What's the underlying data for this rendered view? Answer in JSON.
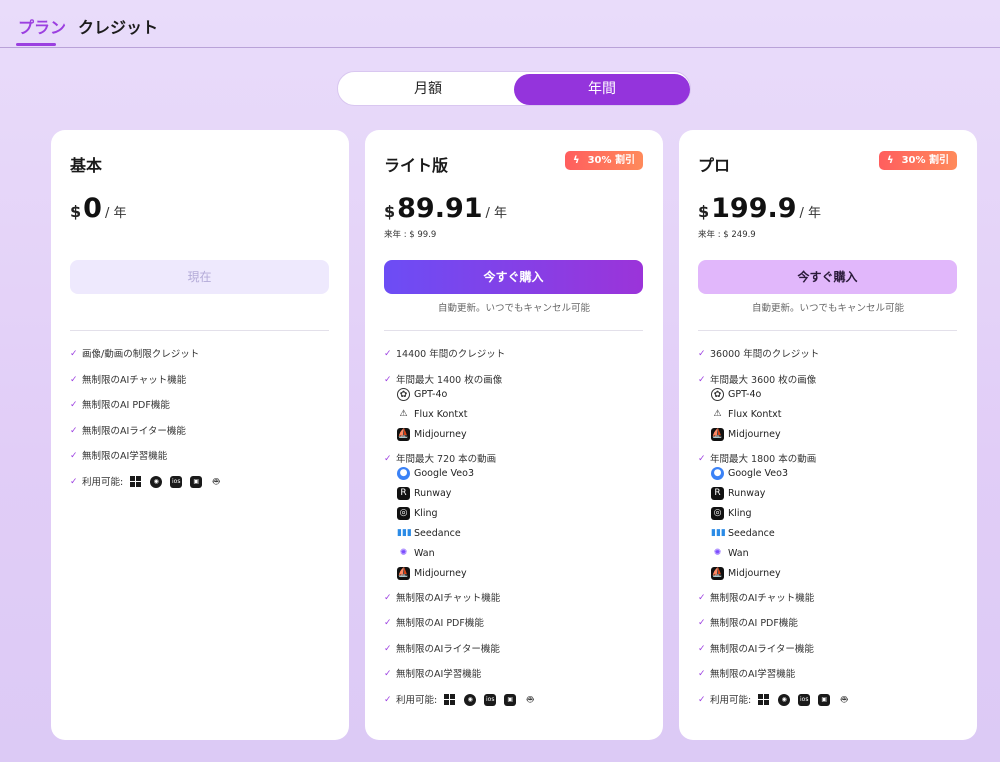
{
  "tabs": [
    {
      "label": "プラン"
    },
    {
      "label": "クレジット"
    }
  ],
  "billing_toggle": {
    "monthly": "月額",
    "yearly": "年間",
    "selected": "yearly"
  },
  "colors": {
    "accent": "#9434dc",
    "badge": "#ff6a5b",
    "check": "#9b3fe0"
  },
  "cards": [
    {
      "title": "基本",
      "currency": "$",
      "price": "0",
      "unit": "/ 年",
      "cta": "現在",
      "features": [
        "画像/動画の制限クレジット",
        "無制限のAIチャット機能",
        "無制限のAI PDF機能",
        "無制限のAIライター機能",
        "無制限のAI学習機能",
        "利用可能:"
      ]
    },
    {
      "title": "ライト版",
      "badge": "30% 割引",
      "currency": "$",
      "price": "89.91",
      "unit": "/ 年",
      "next_year": "来年 : $ 99.9",
      "cta": "今すぐ購入",
      "renew_note": "自動更新。いつでもキャンセル可能",
      "credits": "14400 年間のクレジット",
      "images_head": "年間最大 1400 枚の画像",
      "image_models": [
        "GPT-4o",
        "Flux Kontxt",
        "Midjourney"
      ],
      "videos_head": "年間最大 720 本の動画",
      "video_models": [
        "Google Veo3",
        "Runway",
        "Kling",
        "Seedance",
        "Wan",
        "Midjourney"
      ],
      "features": [
        "無制限のAIチャット機能",
        "無制限のAI PDF機能",
        "無制限のAIライター機能",
        "無制限のAI学習機能",
        "利用可能:"
      ]
    },
    {
      "title": "プロ",
      "badge": "30% 割引",
      "currency": "$",
      "price": "199.9",
      "unit": "/ 年",
      "next_year": "来年 : $ 249.9",
      "cta": "今すぐ購入",
      "renew_note": "自動更新。いつでもキャンセル可能",
      "credits": "36000 年間のクレジット",
      "images_head": "年間最大 3600 枚の画像",
      "image_models": [
        "GPT-4o",
        "Flux Kontxt",
        "Midjourney"
      ],
      "videos_head": "年間最大 1800 本の動画",
      "video_models": [
        "Google Veo3",
        "Runway",
        "Kling",
        "Seedance",
        "Wan",
        "Midjourney"
      ],
      "features": [
        "無制限のAIチャット機能",
        "無制限のAI PDF機能",
        "無制限のAIライター機能",
        "無制限のAI学習機能",
        "利用可能:"
      ]
    }
  ],
  "platform_icons": [
    "windows-icon",
    "macos-icon",
    "ios-icon",
    "ipad-icon",
    "android-icon"
  ],
  "model_icons": {
    "GPT-4o": "openai-icon",
    "Flux Kontxt": "flux-icon",
    "Midjourney": "midjourney-icon",
    "Google Veo3": "veo-icon",
    "Runway": "runway-icon",
    "Kling": "kling-icon",
    "Seedance": "seedance-icon",
    "Wan": "wan-icon"
  }
}
